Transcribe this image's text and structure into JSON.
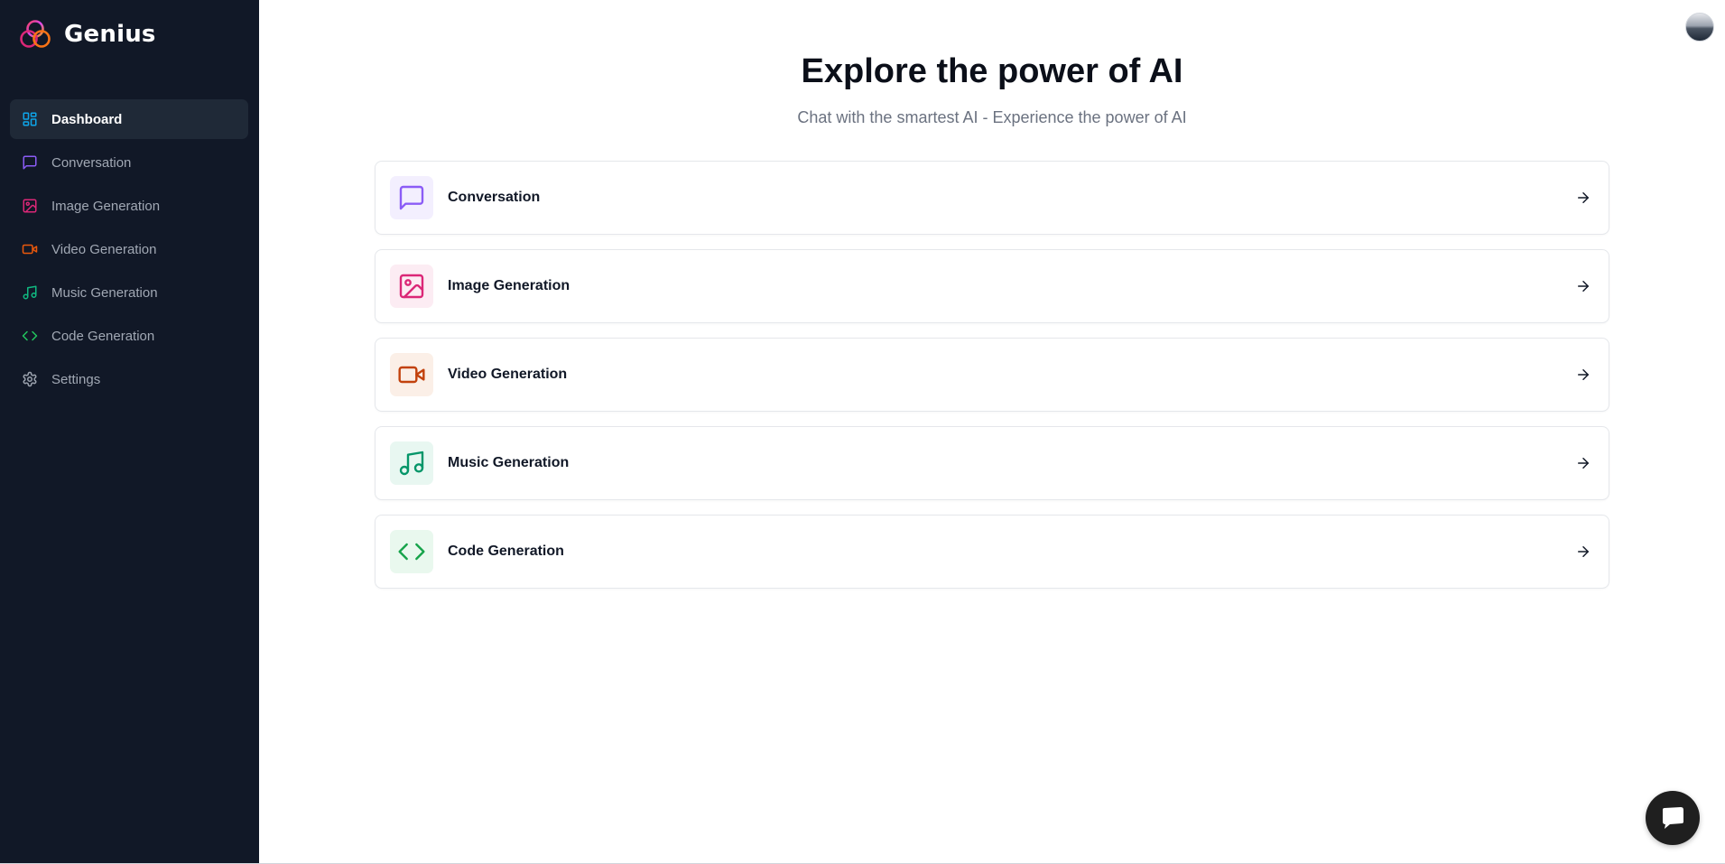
{
  "brand": {
    "name": "Genius"
  },
  "sidebar": {
    "items": [
      {
        "label": "Dashboard",
        "icon": "layout-dashboard-icon",
        "color": "#0ea5e9",
        "active": true
      },
      {
        "label": "Conversation",
        "icon": "message-square-icon",
        "color": "#8b5cf6",
        "active": false
      },
      {
        "label": "Image Generation",
        "icon": "image-icon",
        "color": "#db2777",
        "active": false
      },
      {
        "label": "Video Generation",
        "icon": "video-icon",
        "color": "#ea580c",
        "active": false
      },
      {
        "label": "Music Generation",
        "icon": "music-icon",
        "color": "#10b981",
        "active": false
      },
      {
        "label": "Code Generation",
        "icon": "code-icon",
        "color": "#22c55e",
        "active": false
      },
      {
        "label": "Settings",
        "icon": "settings-icon",
        "color": "#9ca3af",
        "active": false
      }
    ]
  },
  "main": {
    "title": "Explore the power of AI",
    "subtitle": "Chat with the smartest AI - Experience the power of AI",
    "tools": [
      {
        "label": "Conversation",
        "icon": "message-square-icon",
        "color": "#8b5cf6",
        "bg": "#f3effe"
      },
      {
        "label": "Image Generation",
        "icon": "image-icon",
        "color": "#db2777",
        "bg": "#fcecf3"
      },
      {
        "label": "Video Generation",
        "icon": "video-icon",
        "color": "#c2410c",
        "bg": "#fbefe7"
      },
      {
        "label": "Music Generation",
        "icon": "music-icon",
        "color": "#059669",
        "bg": "#e8f7f1"
      },
      {
        "label": "Code Generation",
        "icon": "code-icon",
        "color": "#16a34a",
        "bg": "#e9f8ee"
      }
    ]
  },
  "colors": {
    "sidebar_bg": "#111827",
    "active_item_bg": "#1f2937"
  }
}
